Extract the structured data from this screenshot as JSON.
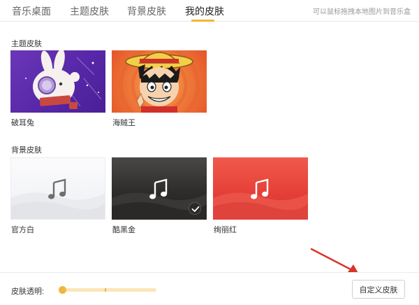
{
  "tabs": [
    {
      "label": "音乐桌面",
      "active": false
    },
    {
      "label": "主题皮肤",
      "active": false
    },
    {
      "label": "背景皮肤",
      "active": false
    },
    {
      "label": "我的皮肤",
      "active": true
    }
  ],
  "hint": "可以鼠标拖拽本地图片到音乐盒",
  "sections": {
    "theme": {
      "title": "主题皮肤",
      "items": [
        {
          "label": "破耳兔",
          "icon": "rabbit-illustration"
        },
        {
          "label": "海贼王",
          "icon": "luffy-illustration"
        }
      ]
    },
    "background": {
      "title": "背景皮肤",
      "items": [
        {
          "label": "官方白",
          "icon": "music-note-icon",
          "selected": false
        },
        {
          "label": "酷黑金",
          "icon": "music-note-icon",
          "selected": true
        },
        {
          "label": "绚丽红",
          "icon": "music-note-icon",
          "selected": false
        }
      ]
    }
  },
  "footer": {
    "opacity_label": "皮肤透明:",
    "opacity_value": 0,
    "custom_button": "自定义皮肤"
  },
  "colors": {
    "accent": "#f2b632",
    "arrow": "#d9342b"
  }
}
